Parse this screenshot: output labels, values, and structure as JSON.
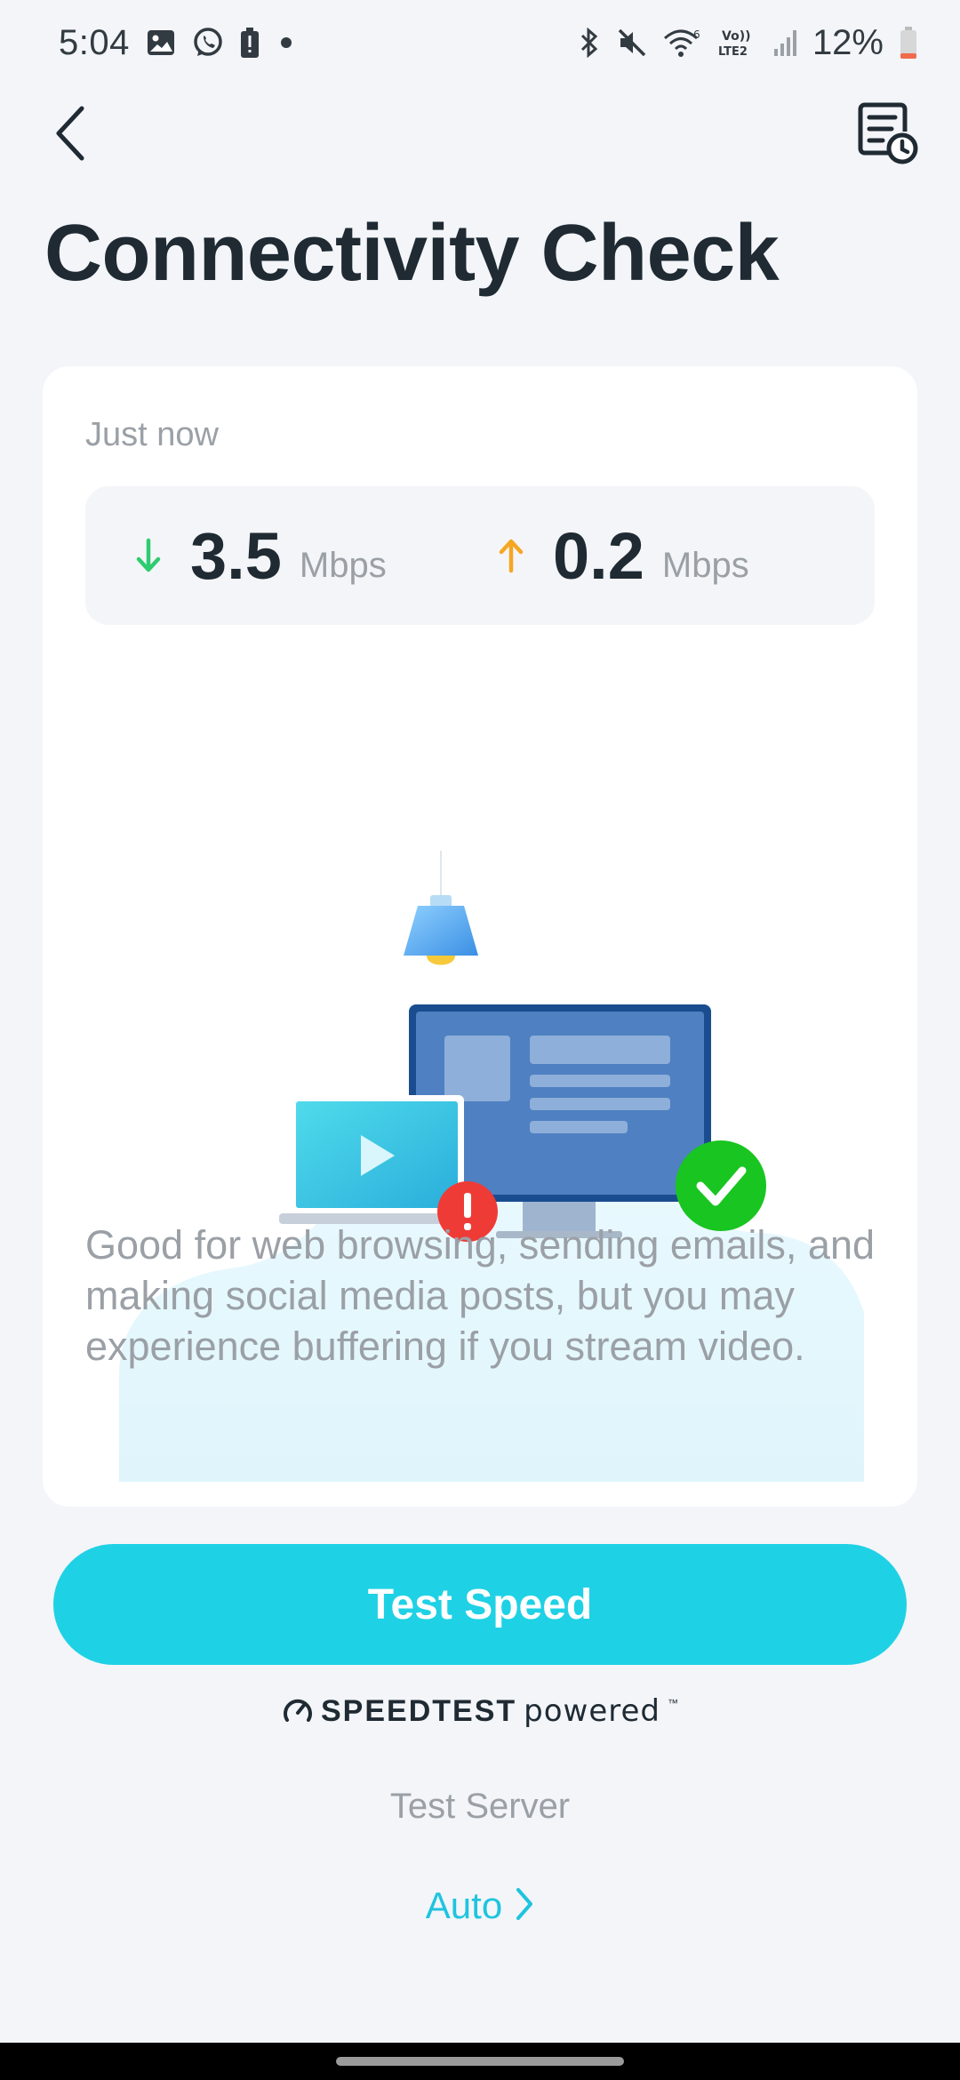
{
  "status_bar": {
    "time": "5:04",
    "battery_percent": "12%",
    "icons_left": [
      "gallery-icon",
      "whatsapp-icon",
      "battery-alert-icon",
      "dot"
    ],
    "icons_right": [
      "bluetooth-icon",
      "mute-icon",
      "wifi-6-icon",
      "volte-lte2-icon",
      "signal-icon",
      "battery-icon"
    ]
  },
  "header": {
    "title": "Connectivity Check",
    "back_icon": "chevron-left-icon",
    "history_icon": "history-document-icon"
  },
  "result": {
    "timestamp": "Just now",
    "download": {
      "value": "3.5",
      "unit": "Mbps",
      "arrow_color": "#2ecc71"
    },
    "upload": {
      "value": "0.2",
      "unit": "Mbps",
      "arrow_color": "#f5a623"
    },
    "description": "Good for web browsing, sending emails, and making social media posts, but you may experience buffering if you stream video."
  },
  "actions": {
    "test_speed_label": "Test Speed"
  },
  "branding": {
    "brand": "SPEEDTEST",
    "powered": "powered",
    "tm": "™"
  },
  "server": {
    "label": "Test Server",
    "value": "Auto"
  },
  "colors": {
    "accent": "#1fd1e5",
    "background": "#f3f5f9",
    "card": "#ffffff",
    "title": "#1f2a33",
    "muted": "#9aa0a6",
    "ok_green": "#19c520",
    "error_red": "#ef3b36"
  }
}
